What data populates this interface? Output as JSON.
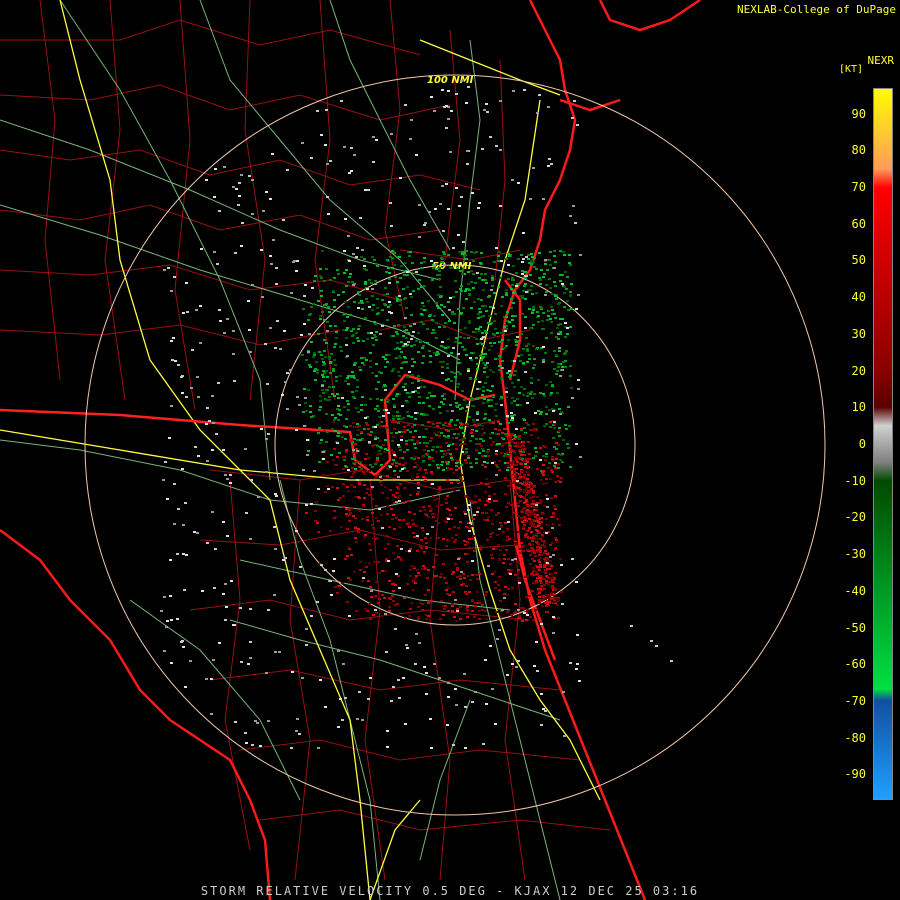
{
  "header": {
    "credit": "NEXLAB-College of DuPage",
    "product_code": "NEXR",
    "units": "[KT]"
  },
  "footer": {
    "caption": "STORM RELATIVE VELOCITY 0.5 DEG - KJAX 12 DEC 25 03:16"
  },
  "map": {
    "station": "KJAX",
    "range_rings": [
      {
        "label": "50 NMI"
      },
      {
        "label": "100 NMI"
      }
    ],
    "colors": {
      "coastline": "#ff1a1a",
      "county_lines": "#9a1010",
      "state_border": "#ff2020",
      "highways_interstate": "#ffff40",
      "roads": "#8fd48f",
      "range_ring": "#f0c8a8"
    }
  },
  "legend": {
    "ticks": [
      {
        "value": "90"
      },
      {
        "value": "80"
      },
      {
        "value": "70"
      },
      {
        "value": "60"
      },
      {
        "value": "50"
      },
      {
        "value": "40"
      },
      {
        "value": "30"
      },
      {
        "value": "20"
      },
      {
        "value": "10"
      },
      {
        "value": "0"
      },
      {
        "value": "-10"
      },
      {
        "value": "-20"
      },
      {
        "value": "-30"
      },
      {
        "value": "-40"
      },
      {
        "value": "-50"
      },
      {
        "value": "-60"
      },
      {
        "value": "-70"
      },
      {
        "value": "-80"
      },
      {
        "value": "-90"
      }
    ],
    "range_kt": [
      -97,
      97
    ],
    "stops": [
      {
        "kt": 97,
        "color": "#ffff00"
      },
      {
        "kt": 75,
        "color": "#ff9a5a"
      },
      {
        "kt": 70,
        "color": "#ff0000"
      },
      {
        "kt": 20,
        "color": "#8a0000"
      },
      {
        "kt": 10,
        "color": "#5a0000"
      },
      {
        "kt": 5,
        "color": "#d0d0d0"
      },
      {
        "kt": -5,
        "color": "#808080"
      },
      {
        "kt": -10,
        "color": "#004a00"
      },
      {
        "kt": -67,
        "color": "#00e040"
      },
      {
        "kt": -70,
        "color": "#1050a0"
      },
      {
        "kt": -97,
        "color": "#20a0ff"
      }
    ]
  }
}
